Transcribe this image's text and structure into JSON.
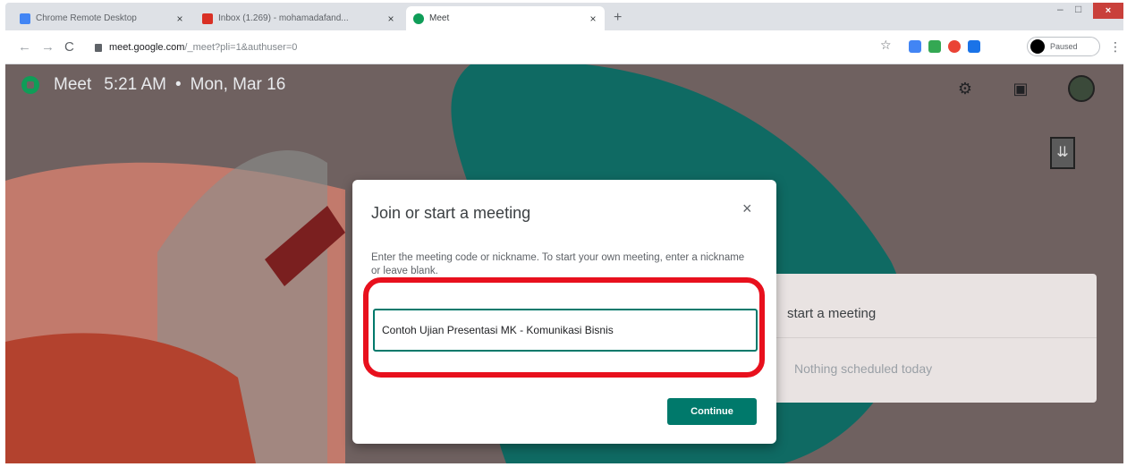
{
  "browser": {
    "tabs": [
      {
        "title": "Chrome Remote Desktop",
        "active": false,
        "favicon_color": "#4285f4"
      },
      {
        "title": "Inbox (1.269) - mohamadafand...",
        "active": false,
        "favicon_color": "#d93025"
      },
      {
        "title": "Meet",
        "active": true,
        "favicon_color": "#0f9d58"
      }
    ],
    "new_tab_symbol": "+",
    "close_symbol": "×",
    "window_controls": {
      "minimize": "–",
      "maximize": "□",
      "close": "×"
    },
    "nav": {
      "back": "←",
      "forward": "→",
      "reload": "C"
    },
    "url_host": "meet.google.com",
    "url_path": "/_meet?pli=1&authuser=0",
    "bookmark_symbol": "☆",
    "extension_colors": [
      "#4285f4",
      "#34a853",
      "#ea4335",
      "#1a73e8"
    ],
    "profile_label": "Paused",
    "menu_symbol": "⋮"
  },
  "meet": {
    "app_name": "Meet",
    "time": "5:21 AM",
    "separator": "•",
    "date": "Mon, Mar 16",
    "settings_symbol": "⚙",
    "feedback_symbol": "▣",
    "side_symbol": "⇊",
    "card": {
      "start_label": "start a meeting",
      "schedule_status": "Nothing scheduled today"
    }
  },
  "dialog": {
    "title": "Join or start a meeting",
    "close_symbol": "×",
    "description": "Enter the meeting code or nickname. To start your own meeting, enter a nickname or leave blank.",
    "input_value": "Contoh Ujian Presentasi MK - Komunikasi Bisnis",
    "continue_label": "Continue"
  },
  "colors": {
    "accent": "#00796b",
    "highlight": "#e8101d",
    "page_bg": "#6f6160"
  }
}
